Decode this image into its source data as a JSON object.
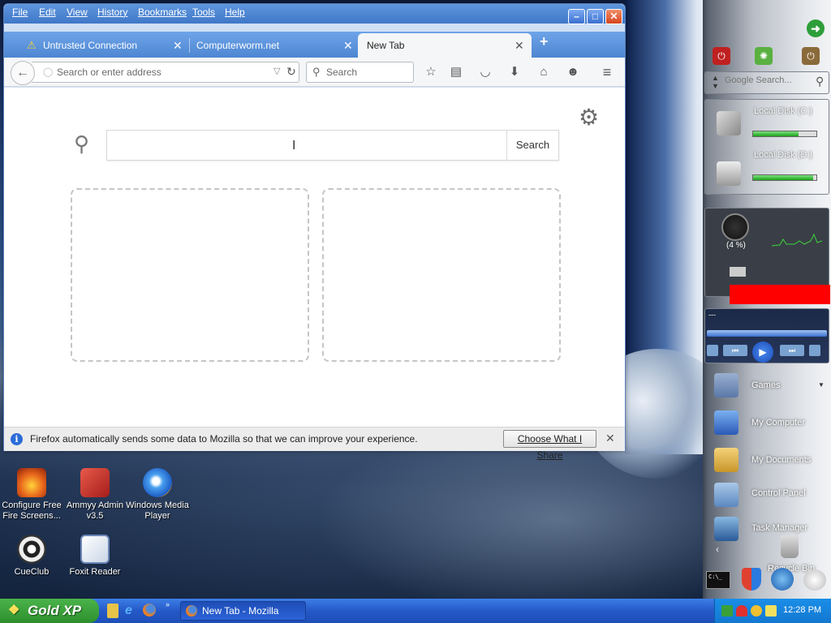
{
  "browser": {
    "menu": [
      "File",
      "Edit",
      "View",
      "History",
      "Bookmarks",
      "Tools",
      "Help"
    ],
    "tabs": [
      {
        "title": "Untrusted Connection",
        "warning": true
      },
      {
        "title": "Computerworm.net",
        "warning": false
      },
      {
        "title": "New Tab",
        "active": true
      }
    ],
    "url_placeholder": "Search or enter address",
    "search_placeholder": "Search",
    "newtab_search_button": "Search",
    "notice": {
      "message": "Firefox automatically sends some data to Mozilla so that we can improve your experience.",
      "button": "Choose What I Share"
    }
  },
  "desktop_icons": [
    {
      "label": "Configure Free Fire Screens...",
      "color": "#e8661c"
    },
    {
      "label": "Ammyy Admin v3.5",
      "color": "#c2302c"
    },
    {
      "label": "Windows Media Player",
      "color": "#2a7bd4"
    },
    {
      "label": "CueClub",
      "color": "#222222"
    },
    {
      "label": "Foxit Reader",
      "color": "#dfe6ef"
    }
  ],
  "sidebar": {
    "google_search_placeholder": "Google Search...",
    "disks": [
      {
        "label": "Local Disk (C:)",
        "used": 0.72
      },
      {
        "label": "Local Disk (D:)",
        "used": 0.95
      }
    ],
    "cpu_percent": "(4 %)",
    "media_text": "---",
    "items": [
      "Games",
      "My Computer",
      "My Documents",
      "Control Panel",
      "Task Manager",
      "Recycle Bin"
    ]
  },
  "taskbar": {
    "start_label": "Gold XP",
    "active_window": "New Tab - Mozilla Fire...",
    "clock": "12:28 PM"
  }
}
